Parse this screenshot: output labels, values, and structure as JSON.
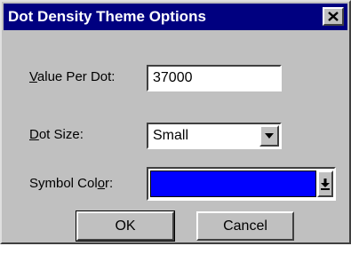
{
  "window": {
    "title": "Dot Density Theme Options"
  },
  "fields": {
    "value_per_dot": {
      "label_mnemonic": "V",
      "label_rest": "alue Per Dot:",
      "value": "37000"
    },
    "dot_size": {
      "label_mnemonic": "D",
      "label_rest": "ot Size:",
      "value": "Small"
    },
    "symbol_color": {
      "label_pre": "Symbol Col",
      "label_mnemonic": "o",
      "label_post": "r:",
      "color": "#0000ff"
    }
  },
  "buttons": {
    "ok": "OK",
    "cancel": "Cancel"
  },
  "icons": {
    "close": "close-icon",
    "dropdown": "chevron-down-icon",
    "color_dropdown": "arrow-down-bar-icon"
  }
}
